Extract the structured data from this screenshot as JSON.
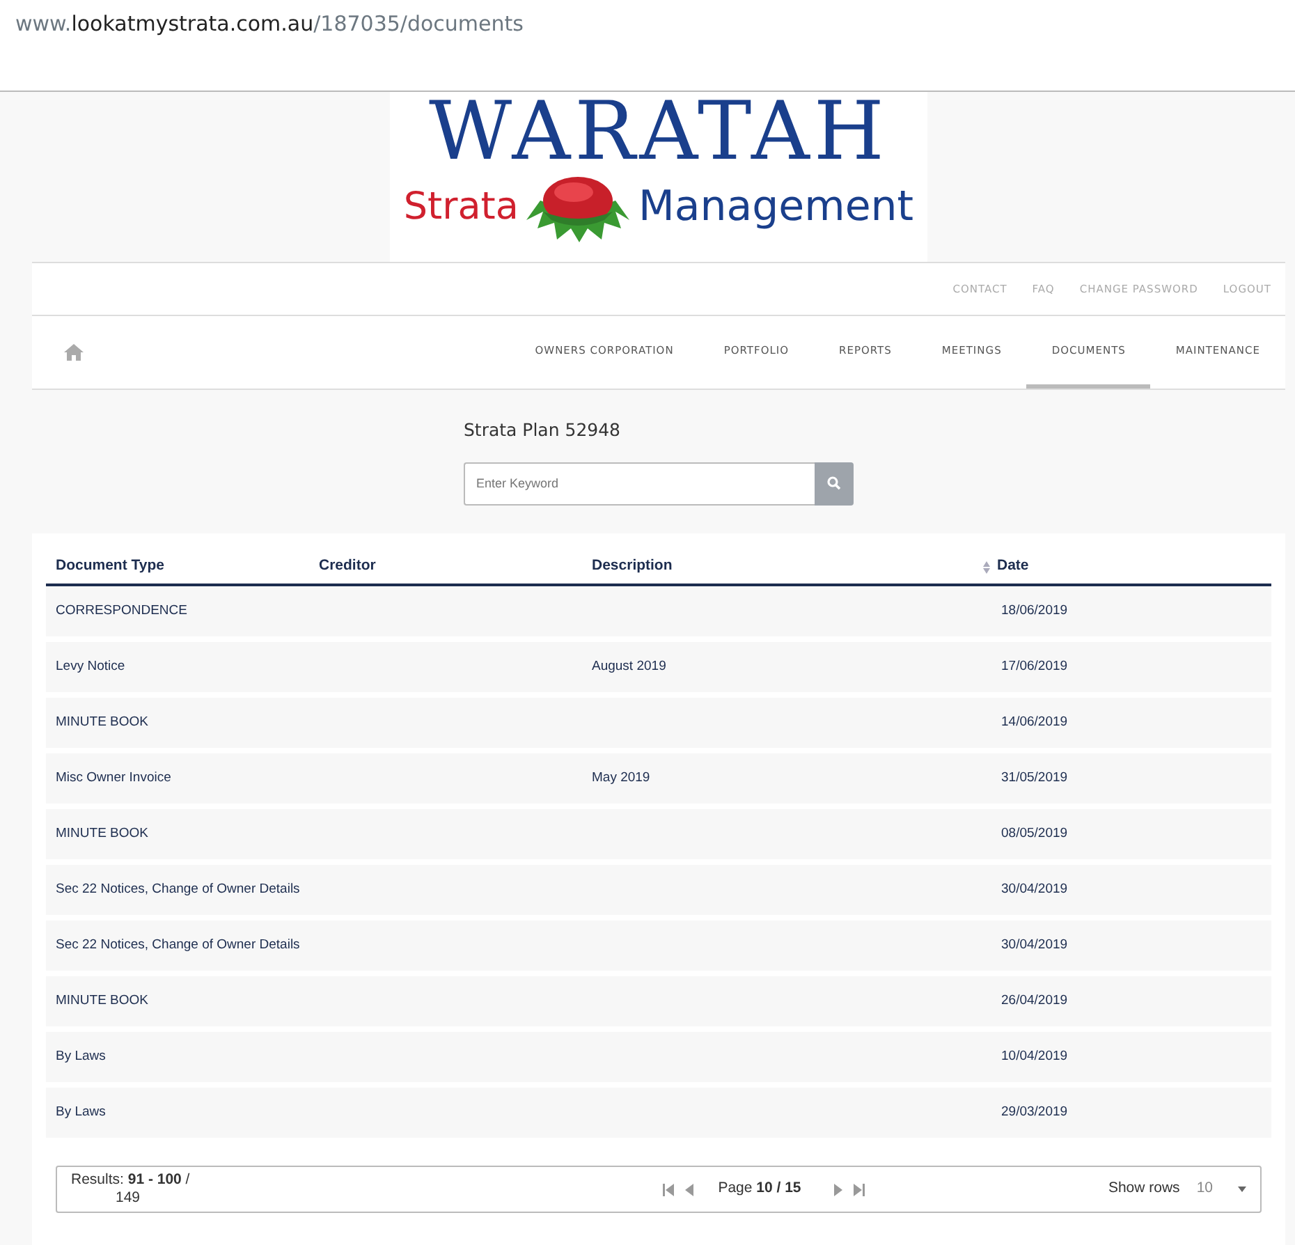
{
  "address_bar": {
    "prefix": "www.",
    "domain": "lookatmystrata.com.au",
    "path": "/187035/documents"
  },
  "logo": {
    "title": "WARATAH",
    "word_1": "Strata",
    "word_2": "Management"
  },
  "top_links": [
    "CONTACT",
    "FAQ",
    "CHANGE PASSWORD",
    "LOGOUT"
  ],
  "nav": [
    {
      "label": "OWNERS CORPORATION",
      "selected": false
    },
    {
      "label": "PORTFOLIO",
      "selected": false
    },
    {
      "label": "REPORTS",
      "selected": false
    },
    {
      "label": "MEETINGS",
      "selected": false
    },
    {
      "label": "DOCUMENTS",
      "selected": true
    },
    {
      "label": "MAINTENANCE",
      "selected": false
    }
  ],
  "plan_title": "Strata Plan 52948",
  "search": {
    "placeholder": "Enter Keyword"
  },
  "table": {
    "columns": [
      "Document Type",
      "Creditor",
      "Description",
      "Date"
    ],
    "rows": [
      [
        "CORRESPONDENCE",
        "",
        "",
        "18/06/2019"
      ],
      [
        "Levy Notice",
        "",
        "August 2019",
        "17/06/2019"
      ],
      [
        "MINUTE BOOK",
        "",
        "",
        "14/06/2019"
      ],
      [
        "Misc Owner Invoice",
        "",
        "May 2019",
        "31/05/2019"
      ],
      [
        "MINUTE BOOK",
        "",
        "",
        "08/05/2019"
      ],
      [
        "Sec 22 Notices, Change of Owner Details",
        "",
        "",
        "30/04/2019"
      ],
      [
        "Sec 22 Notices, Change of Owner Details",
        "",
        "",
        "30/04/2019"
      ],
      [
        "MINUTE BOOK",
        "",
        "",
        "26/04/2019"
      ],
      [
        "By Laws",
        "",
        "",
        "10/04/2019"
      ],
      [
        "By Laws",
        "",
        "",
        "29/03/2019"
      ]
    ]
  },
  "pager": {
    "results_label": "Results:",
    "results_range": "91 - 100",
    "results_sep": "/",
    "results_total": "149",
    "page_label": "Page",
    "page_value": "10 / 15",
    "show_rows_label": "Show rows",
    "rows_value": "10"
  }
}
